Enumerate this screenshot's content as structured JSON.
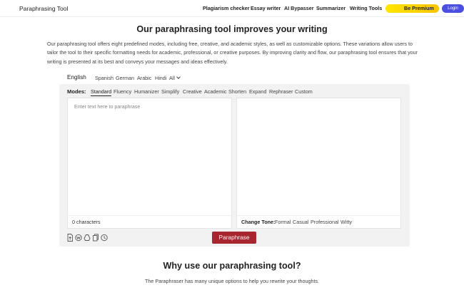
{
  "nav": {
    "brand": "Paraphrasing Tool",
    "links": [
      "Plagiarism checker",
      "Essay writer",
      "AI Bypasser",
      "Summarizer",
      "Writing Tools"
    ],
    "premium_label": "Be Premium",
    "login_label": "Login",
    "premium_color": "#ffe600",
    "login_color": "#4b4fe0"
  },
  "hero": {
    "title": "Our paraphrasing tool improves your writing",
    "intro": "Our paraphrasing tool offers eight predefined modes, including free, creative, and academic styles, as well as customizable options. These variations allow users to tailor the tool to their specific formatting needs for academic, professional, or creative purposes. By improving clarity and flow, our paraphrasing tool ensures that your writing is presented at its best and conveys your messages and ideas effectively."
  },
  "languages": {
    "selected": "English",
    "options": [
      "Spanish",
      "German",
      "Arabic",
      "Hindi"
    ],
    "all_label": "All"
  },
  "modes": {
    "label": "Modes:",
    "selected": "Standard",
    "items": [
      "Standard",
      "Fluency",
      "Humanizer",
      "Simplify",
      "Creative",
      "Academic",
      "Shorten",
      "Expand",
      "Rephraser",
      "Custom"
    ]
  },
  "editor": {
    "placeholder": "Enter text here to paraphrase",
    "char_count": "0 characters"
  },
  "tone": {
    "label": "Change Tone:",
    "options": [
      "Formal",
      "Casual",
      "Professional",
      "Witty"
    ]
  },
  "toolbar": {
    "icons": [
      "upload-file-icon",
      "word-file-icon",
      "google-drive-icon",
      "copy-icon",
      "history-icon"
    ],
    "paraphrase_label": "Paraphrase",
    "paraphrase_color": "#a7262f"
  },
  "why": {
    "title": "Why use our paraphrasing tool?",
    "subtitle": "The Paraphraser has many unique options to help you rewrite your thoughts."
  }
}
